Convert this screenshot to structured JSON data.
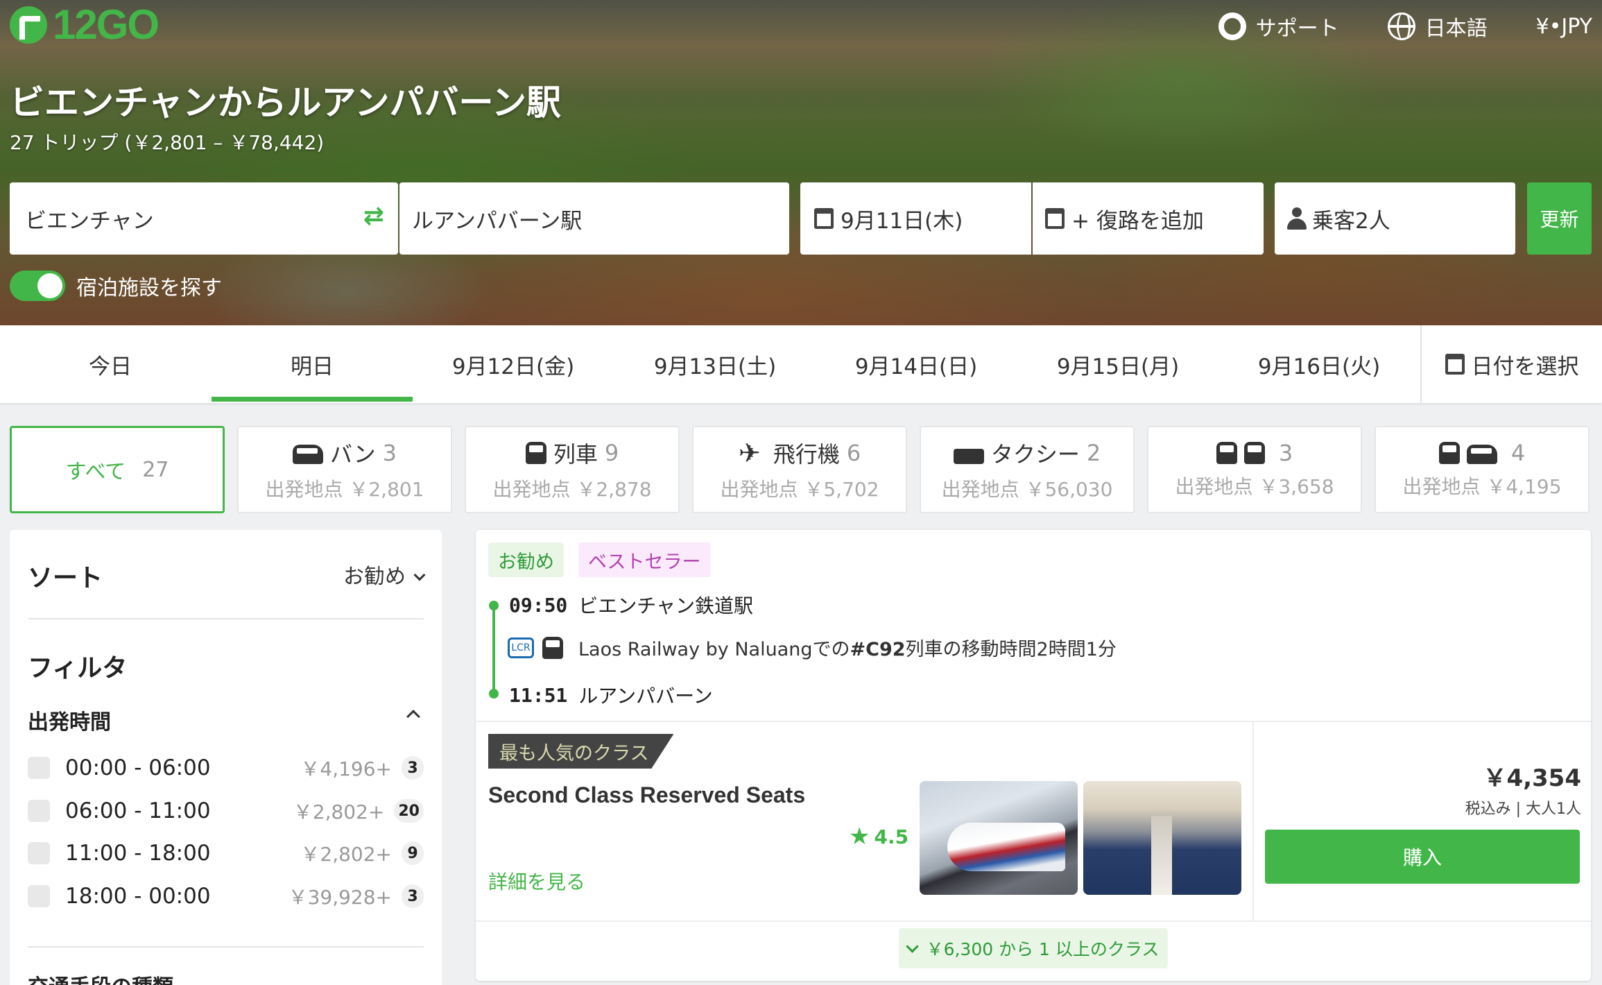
{
  "brand": {
    "logo_text": "12GO",
    "accent": "#43b649"
  },
  "nav": {
    "support": "サポート",
    "language": "日本語",
    "currency": "¥•JPY"
  },
  "hero": {
    "title": "ビエンチャンからルアンパバーン駅",
    "subtitle": "27 トリップ (￥2,801 – ￥78,442)"
  },
  "search": {
    "from": "ビエンチャン",
    "to": "ルアンパバーン駅",
    "date": "9月11日(木)",
    "return": "+ 復路を追加",
    "passengers": "乗客2人",
    "update": "更新",
    "accommodation_toggle": "宿泊施設を探す",
    "accommodation_on": true
  },
  "dates": {
    "tabs": [
      "今日",
      "明日",
      "9月12日(金)",
      "9月13日(土)",
      "9月14日(日)",
      "9月15日(月)",
      "9月16日(火)"
    ],
    "active_index": 1,
    "picker": "日付を選択"
  },
  "modes": [
    {
      "label": "すべて",
      "count": "27",
      "price": ""
    },
    {
      "label": "バン",
      "count": "3",
      "price": "出発地点 ￥2,801",
      "icon": "van-icon"
    },
    {
      "label": "列車",
      "count": "9",
      "price": "出発地点 ￥2,878",
      "icon": "train-icon"
    },
    {
      "label": "飛行機",
      "count": "6",
      "price": "出発地点 ￥5,702",
      "icon": "plane-icon"
    },
    {
      "label": "タクシー",
      "count": "2",
      "price": "出発地点 ￥56,030",
      "icon": "taxi-icon"
    },
    {
      "label": "",
      "count": "3",
      "price": "出発地点 ￥3,658",
      "icon": "bus-train-icon"
    },
    {
      "label": "",
      "count": "4",
      "price": "出発地点 ￥4,195",
      "icon": "train-van-icon"
    }
  ],
  "sidebar": {
    "sort_title": "ソート",
    "sort_value": "お勧め",
    "filter_title": "フィルタ",
    "departure_title": "出発時間",
    "departure_rows": [
      {
        "label": "00:00 - 06:00",
        "price": "￥4,196+",
        "count": "3"
      },
      {
        "label": "06:00 - 11:00",
        "price": "￥2,802+",
        "count": "20"
      },
      {
        "label": "11:00 - 18:00",
        "price": "￥2,802+",
        "count": "9"
      },
      {
        "label": "18:00 - 00:00",
        "price": "￥39,928+",
        "count": "3"
      }
    ],
    "transport_title": "交通手段の種類"
  },
  "result": {
    "badges": [
      "お勧め",
      "ベストセラー"
    ],
    "dep_time": "09:50",
    "dep_station": "ビエンチャン鉄道駅",
    "operator_prefix": "Laos Railway by Naluangでの",
    "train_no": "#C92",
    "operator_suffix": "列車の移動時間2時間1分",
    "arr_time": "11:51",
    "arr_station": "ルアンパバーン",
    "popular_label": "最も人気のクラス",
    "class_name": "Second Class Reserved Seats",
    "rating": "4.5",
    "details": "詳細を見る",
    "price": "￥4,354",
    "price_note": "税込み | 大人1人",
    "buy": "購入",
    "more_classes": "￥6,300 から 1 以上のクラス"
  }
}
